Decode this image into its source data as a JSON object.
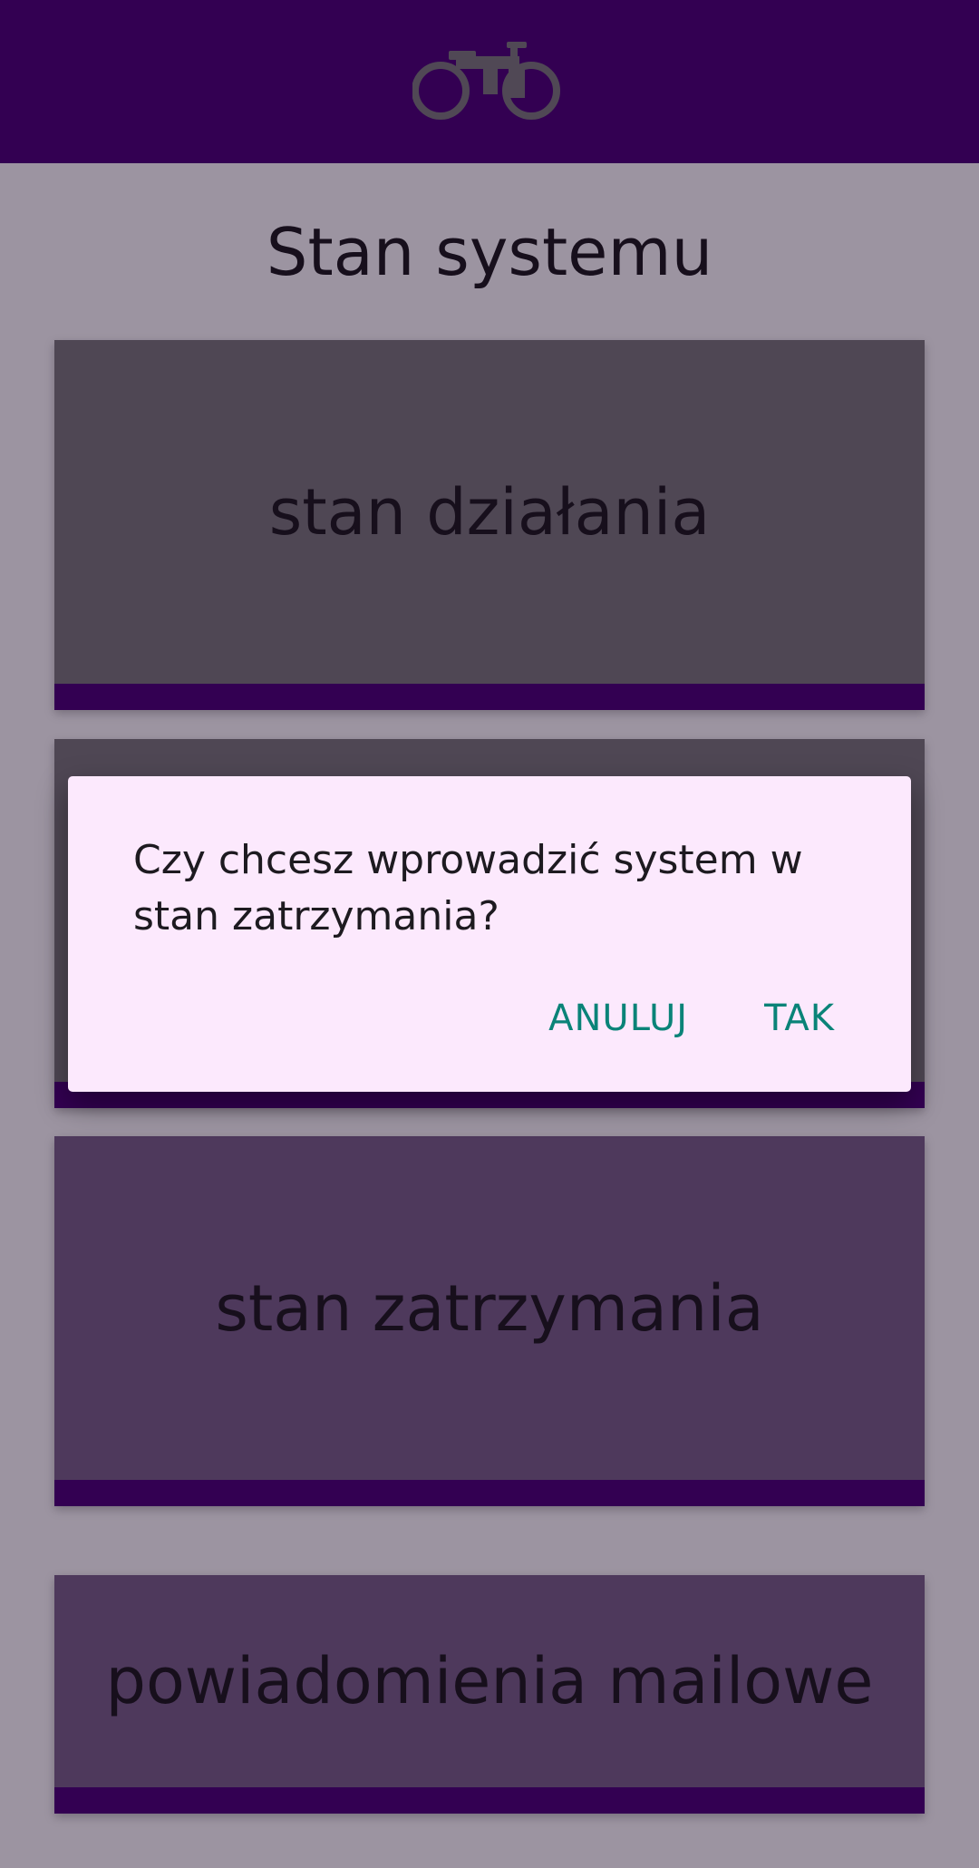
{
  "header": {
    "logo_icon": "bicycle-icon"
  },
  "page": {
    "title": "Stan systemu"
  },
  "cards": [
    {
      "label": "stan działania"
    },
    {
      "label": ""
    },
    {
      "label": "stan zatrzymania"
    },
    {
      "label": "powiadomienia mailowe"
    }
  ],
  "dialog": {
    "message": "Czy chcesz wprowadzić system w stan zatrzymania?",
    "cancel_label": "ANULUJ",
    "confirm_label": "TAK"
  },
  "colors": {
    "app_bar": "#4a0077",
    "card_strip": "#4a0077",
    "dialog_background": "#fce9fd",
    "dialog_action": "#0a8378"
  }
}
